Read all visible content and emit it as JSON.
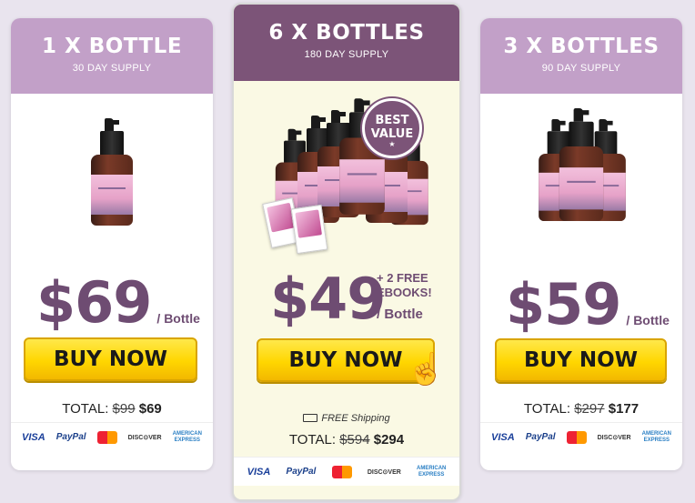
{
  "offers": {
    "left": {
      "title": "1 X BOTTLE",
      "supply": "30 DAY SUPPLY",
      "price": "$69",
      "per": "/ Bottle",
      "buy_label": "BUY NOW",
      "total_label": "TOTAL:",
      "total_old": "$99",
      "total_new": "$69"
    },
    "middle": {
      "title": "6 X BOTTLES",
      "supply": "180 DAY SUPPLY",
      "badge_line1": "BEST",
      "badge_line2": "VALUE",
      "price": "$49",
      "promo_line1": "+ 2 FREE",
      "promo_line2": "EBOOKS!",
      "per": "/ Bottle",
      "buy_label": "BUY NOW",
      "shipping": "FREE Shipping",
      "total_label": "TOTAL:",
      "total_old": "$594",
      "total_new": "$294"
    },
    "right": {
      "title": "3 X BOTTLES",
      "supply": "90 DAY SUPPLY",
      "price": "$59",
      "per": "/ Bottle",
      "buy_label": "BUY NOW",
      "total_label": "TOTAL:",
      "total_old": "$297",
      "total_new": "$177"
    }
  },
  "payments": {
    "visa": "VISA",
    "paypal": "PayPal",
    "discover": "DISC⊙VER",
    "amex_line1": "AMERICAN",
    "amex_line2": "EXPRESS"
  },
  "colors": {
    "header_light": "#c2a0c8",
    "header_dark": "#7c5478",
    "price": "#6e4c72",
    "button": "#ffd600",
    "featured_bg": "#faf9e4"
  },
  "icons": [
    "bottle-product-image",
    "best-value-badge",
    "ebook-image",
    "truck-icon",
    "pointer-hand-icon",
    "visa-icon",
    "paypal-icon",
    "mastercard-icon",
    "discover-icon",
    "amex-icon"
  ]
}
